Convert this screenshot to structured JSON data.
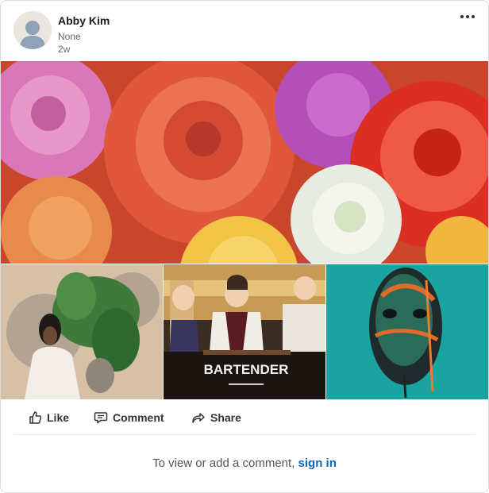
{
  "post": {
    "author_name": "Abby Kim",
    "author_subtitle": "None",
    "timestamp": "2w",
    "menu_icon": "more-horizontal-icon",
    "thumb2_caption": "BARTENDER"
  },
  "actions": {
    "like_label": "Like",
    "comment_label": "Comment",
    "share_label": "Share"
  },
  "footer": {
    "prompt_text": "To view or add a comment,",
    "signin_label": "sign in"
  },
  "colors": {
    "link": "#0a66c2",
    "thumb3_bg": "#1aa3a0"
  }
}
